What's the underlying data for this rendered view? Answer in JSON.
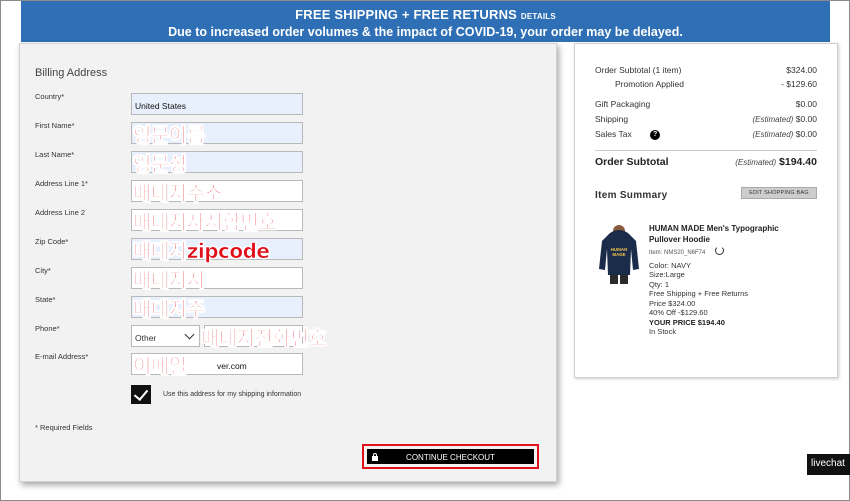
{
  "banner": {
    "headline": "FREE SHIPPING + FREE RETURNS",
    "details_link": "DETAILS",
    "notice": "Due to increased order volumes & the impact of COVID-19, your order may be delayed."
  },
  "billing": {
    "title": "Billing Address",
    "fields": {
      "country": {
        "label": "Country*",
        "value": "United States"
      },
      "first_name": {
        "label": "First Name*",
        "value": "",
        "overlay": "영문이름"
      },
      "last_name": {
        "label": "Last Name*",
        "value": "",
        "overlay": "영문성"
      },
      "address1": {
        "label": "Address Line 1*",
        "value": "",
        "overlay": "배대지주소"
      },
      "address2": {
        "label": "Address Line 2",
        "value": "",
        "overlay": "배대지사서함번호"
      },
      "zip": {
        "label": "Zip Code*",
        "value": "",
        "overlay": "배대지zipcode"
      },
      "city": {
        "label": "City*",
        "value": "",
        "overlay": "배대지시"
      },
      "state": {
        "label": "State*",
        "value": "",
        "overlay": "배대지주"
      },
      "phone": {
        "label": "Phone*",
        "type_value": "Other",
        "value": "",
        "overlay": "배대지전화번호"
      },
      "email": {
        "label": "E-mail Address*",
        "value": "ver.com",
        "overlay": "이메일"
      }
    },
    "same_shipping_label": "Use this address for my shipping information",
    "same_shipping_checked": true,
    "required_note": "* Required Fields",
    "continue_label": "CONTINUE CHECKOUT"
  },
  "summary": {
    "subtotal_label": "Order Subtotal (1 item)",
    "subtotal_value": "$324.00",
    "promo_label": "Promotion Applied",
    "promo_value": "- $129.60",
    "gift_label": "Gift Packaging",
    "gift_value": "$0.00",
    "shipping_label": "Shipping",
    "shipping_est": "(Estimated)",
    "shipping_value": "$0.00",
    "tax_label": "Sales Tax",
    "tax_help": "?",
    "tax_est": "(Estimated)",
    "tax_value": "$0.00",
    "order_subtotal_label": "Order Subtotal",
    "order_subtotal_est": "(Estimated)",
    "order_subtotal_value": "$194.40",
    "item_summary_title": "Item Summary",
    "edit_bag": "EDIT SHOPPING BAG",
    "item": {
      "name": "HUMAN MADE Men's Typographic Pullover Hoodie",
      "code": "Item: NMS20_N6F74",
      "color": "Color: NAVY",
      "size": "Size:Large",
      "qty": "Qty: 1",
      "shipping": "Free Shipping + Free Returns",
      "price": "Price $324.00",
      "discount": "40% Off -$129.60",
      "your_price": "YOUR PRICE $194.40",
      "stock": "In Stock",
      "hoodie_print": "HUMAN MADE",
      "hoodie_color": "#1b2b4a"
    }
  },
  "livechat": "livechat"
}
